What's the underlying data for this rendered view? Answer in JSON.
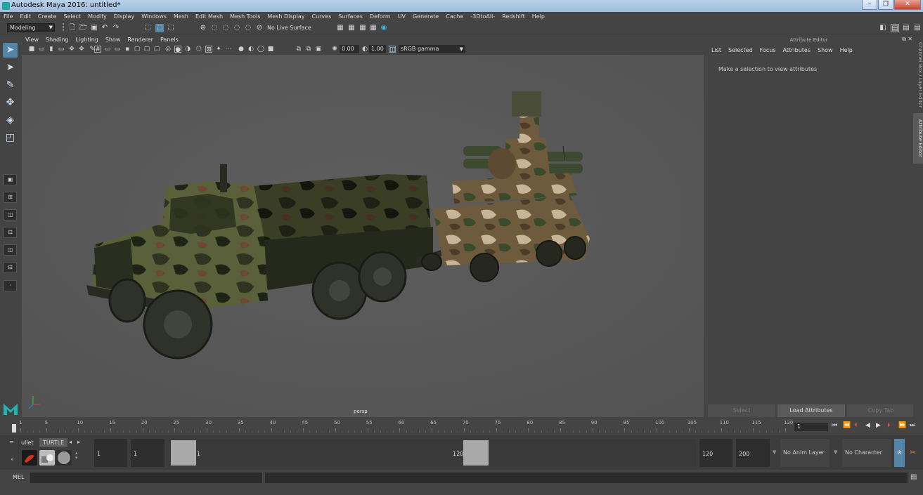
{
  "window": {
    "title": "Autodesk Maya 2016: untitled*",
    "minimize": "–",
    "maximize": "❐",
    "close": "✕"
  },
  "menubar": [
    "File",
    "Edit",
    "Create",
    "Select",
    "Modify",
    "Display",
    "Windows",
    "Mesh",
    "Edit Mesh",
    "Mesh Tools",
    "Mesh Display",
    "Curves",
    "Surfaces",
    "Deform",
    "UV",
    "Generate",
    "Cache",
    "-3DtoAll-",
    "Redshift",
    "Help"
  ],
  "statusline": {
    "menuset": "Modeling",
    "live_surface": "No Live Surface"
  },
  "panel": {
    "menu": [
      "View",
      "Shading",
      "Lighting",
      "Show",
      "Renderer",
      "Panels"
    ],
    "exposure": "0.00",
    "gamma": "1.00",
    "colorspace": "sRGB gamma",
    "camera_label": "persp"
  },
  "attribute_editor": {
    "title": "Attribute Editor",
    "menu": [
      "List",
      "Selected",
      "Focus",
      "Attributes",
      "Show",
      "Help"
    ],
    "message": "Make a selection to view attributes",
    "buttons": [
      "Select",
      "Load Attributes",
      "Copy Tab"
    ],
    "side_tabs": [
      "Channel Box / Layer Editor",
      "Attribute Editor"
    ]
  },
  "timeslider": {
    "ticks": [
      "1",
      "5",
      "10",
      "15",
      "20",
      "25",
      "30",
      "35",
      "40",
      "45",
      "50",
      "55",
      "60",
      "65",
      "70",
      "75",
      "80",
      "85",
      "90",
      "95",
      "100",
      "105",
      "110",
      "115",
      "120"
    ],
    "current_frame": "1"
  },
  "range": {
    "start": "1",
    "playback_start": "1",
    "slider_start_label": "1",
    "slider_end_label": "120",
    "playback_end": "120",
    "end": "200",
    "anim_layer": "No Anim Layer",
    "character_set": "No Character Set"
  },
  "shelf": {
    "tabs": [
      "ullet",
      "TURTLE"
    ]
  },
  "cmdline": {
    "mel_label": "MEL"
  },
  "colors": {
    "accent": "#5285a6",
    "viewport_bg": "#575757",
    "ui_bg": "#444444"
  }
}
